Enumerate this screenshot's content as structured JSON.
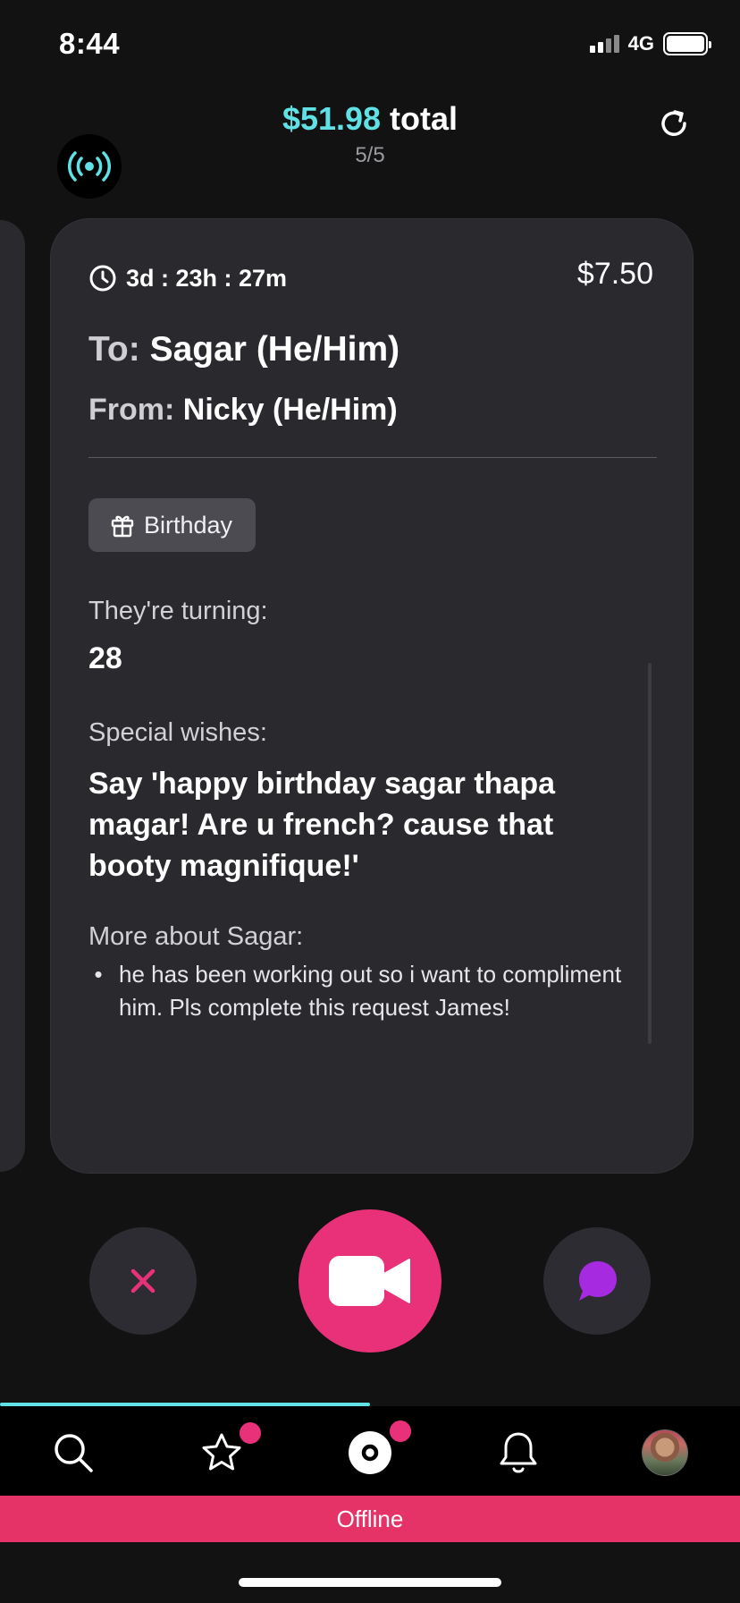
{
  "status_bar": {
    "time": "8:44",
    "network": "4G"
  },
  "header": {
    "total_amount": "$51.98",
    "total_suffix": " total",
    "count": "5/5"
  },
  "card": {
    "timer": "3d : 23h : 27m",
    "price": "$7.50",
    "to_label": "To:",
    "to_name": "Sagar (He/Him)",
    "from_label": "From:",
    "from_name": "Nicky (He/Him)",
    "occasion": "Birthday",
    "turning_label": "They're turning:",
    "turning_value": "28",
    "wishes_label": "Special wishes:",
    "wishes_text": "Say 'happy birthday sagar thapa magar! Are u french? cause that booty magnifique!'",
    "more_label": "More about Sagar:",
    "more_lines": [
      "he has been working out so i want to compliment",
      "him.  Pls complete this request James!"
    ]
  },
  "progress": {
    "fraction": 0.5
  },
  "tabs": [
    "search-icon",
    "star-icon",
    "record-icon",
    "bell-icon",
    "avatar"
  ],
  "offline_text": "Offline",
  "colors": {
    "accent_cyan": "#5fe1e6",
    "accent_pink": "#e9317a",
    "card_bg": "#29292e",
    "chat_purple": "#a52ae0"
  }
}
